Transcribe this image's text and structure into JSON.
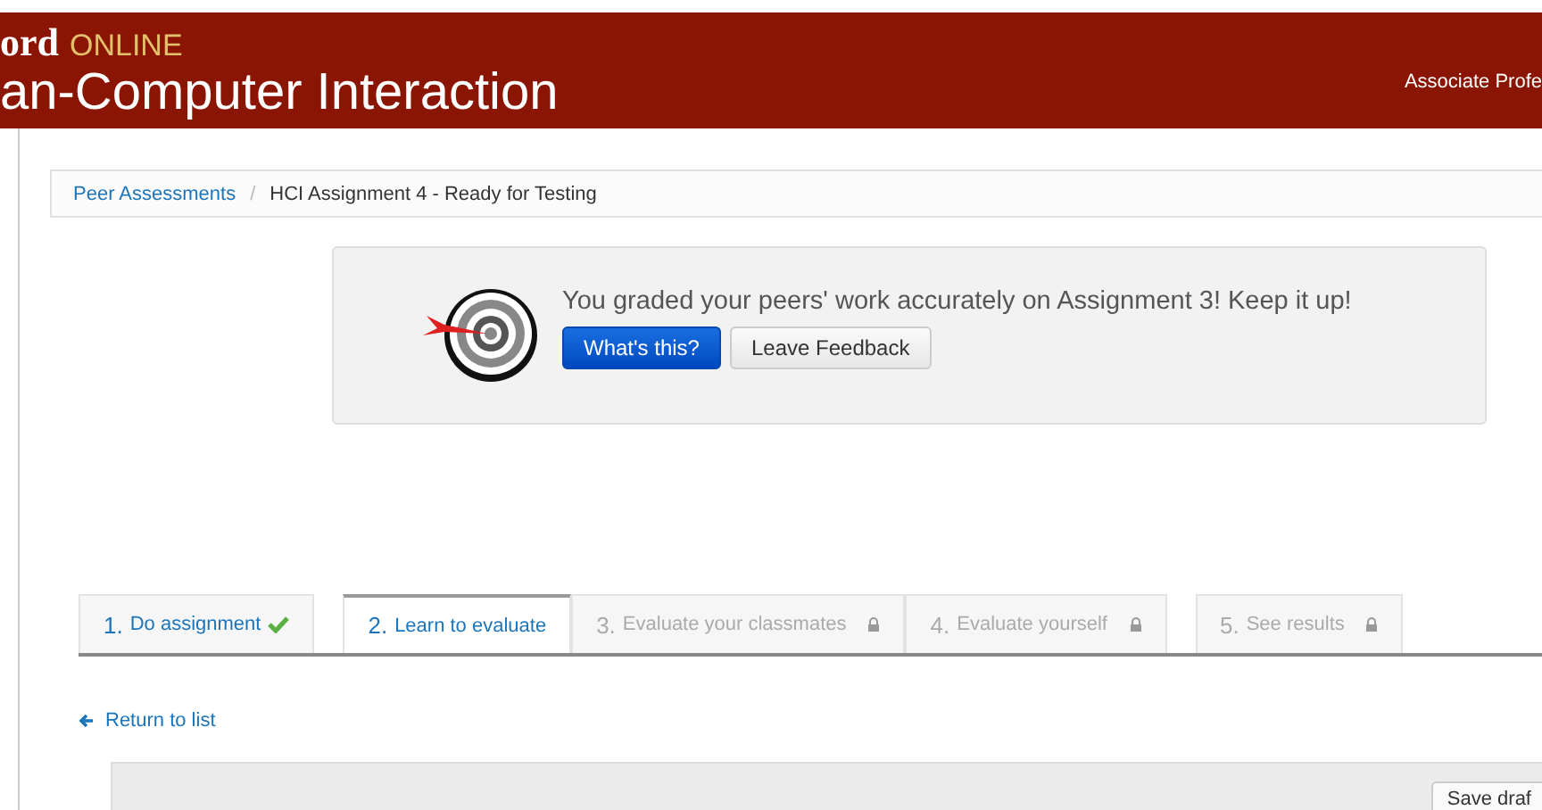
{
  "header": {
    "brand": "ord",
    "brand_suffix": "ONLINE",
    "course": "an-Computer Interaction",
    "user": "Associate Profe"
  },
  "breadcrumb": [
    {
      "label": "Peer Assessments",
      "link": true
    },
    {
      "label": "/",
      "link": false
    },
    {
      "label": "HCI Assignment 4 - Ready for Testing",
      "link": false
    }
  ],
  "banner": {
    "message": "You graded your peers' work accurately on Assignment 3! Keep it up!",
    "buttons": [
      {
        "label": "What's this?",
        "kind": "primary"
      },
      {
        "label": "Leave Feedback",
        "kind": "default"
      }
    ]
  },
  "steps": [
    {
      "number": "1.",
      "label": "Do assignment",
      "selected": false,
      "done": true,
      "locked": false
    },
    {
      "number": "2.",
      "label": "Learn to evaluate",
      "selected": true,
      "done": false,
      "locked": false
    },
    {
      "number": "3.",
      "label": "Evaluate your classmates",
      "selected": false,
      "done": false,
      "locked": true
    },
    {
      "number": "4.",
      "label": "Evaluate yourself",
      "selected": false,
      "done": false,
      "locked": true
    },
    {
      "number": "5.",
      "label": "See results",
      "selected": false,
      "done": false,
      "locked": true
    }
  ],
  "return_link": "Return to list",
  "save_button": "Save draf"
}
